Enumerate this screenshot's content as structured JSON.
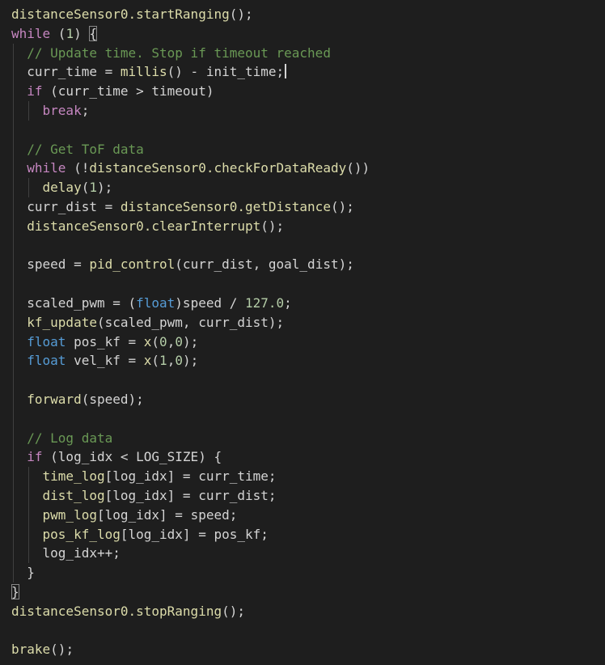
{
  "code": {
    "colors": {
      "background": "#1e1e1e",
      "default": "#d4d4d4",
      "keyword": "#c586c0",
      "function": "#dcdcaa",
      "comment": "#6a9955",
      "number": "#b5cea8",
      "type": "#569cd6",
      "variable": "#9cdcfe"
    },
    "lines": [
      {
        "indent": 0,
        "tokens": [
          {
            "t": "distanceSensor0.startRanging",
            "c": "function"
          },
          {
            "t": "();",
            "c": "default"
          }
        ]
      },
      {
        "indent": 0,
        "tokens": [
          {
            "t": "while",
            "c": "keyword"
          },
          {
            "t": " (",
            "c": "default"
          },
          {
            "t": "1",
            "c": "number"
          },
          {
            "t": ") ",
            "c": "default"
          },
          {
            "t": "{",
            "c": "default",
            "box": true
          }
        ]
      },
      {
        "indent": 1,
        "tokens": [
          {
            "t": "// Update time. Stop if timeout reached",
            "c": "comment"
          }
        ]
      },
      {
        "indent": 1,
        "tokens": [
          {
            "t": "curr_time = ",
            "c": "default"
          },
          {
            "t": "millis",
            "c": "function"
          },
          {
            "t": "() - init_time;",
            "c": "default"
          }
        ],
        "cursor": true
      },
      {
        "indent": 1,
        "tokens": [
          {
            "t": "if",
            "c": "keyword"
          },
          {
            "t": " (curr_time > timeout)",
            "c": "default"
          }
        ]
      },
      {
        "indent": 2,
        "tokens": [
          {
            "t": "break",
            "c": "keyword"
          },
          {
            "t": ";",
            "c": "default"
          }
        ]
      },
      {
        "indent": 1,
        "tokens": []
      },
      {
        "indent": 1,
        "tokens": [
          {
            "t": "// Get ToF data",
            "c": "comment"
          }
        ]
      },
      {
        "indent": 1,
        "tokens": [
          {
            "t": "while",
            "c": "keyword"
          },
          {
            "t": " (!",
            "c": "default"
          },
          {
            "t": "distanceSensor0.checkForDataReady",
            "c": "function"
          },
          {
            "t": "())",
            "c": "default"
          }
        ]
      },
      {
        "indent": 2,
        "tokens": [
          {
            "t": "delay",
            "c": "function"
          },
          {
            "t": "(",
            "c": "default"
          },
          {
            "t": "1",
            "c": "number"
          },
          {
            "t": ");",
            "c": "default"
          }
        ]
      },
      {
        "indent": 1,
        "tokens": [
          {
            "t": "curr_dist = ",
            "c": "default"
          },
          {
            "t": "distanceSensor0.getDistance",
            "c": "function"
          },
          {
            "t": "();",
            "c": "default"
          }
        ]
      },
      {
        "indent": 1,
        "tokens": [
          {
            "t": "distanceSensor0.clearInterrupt",
            "c": "function"
          },
          {
            "t": "();",
            "c": "default"
          }
        ]
      },
      {
        "indent": 1,
        "tokens": []
      },
      {
        "indent": 1,
        "tokens": [
          {
            "t": "speed = ",
            "c": "default"
          },
          {
            "t": "pid_control",
            "c": "function"
          },
          {
            "t": "(curr_dist, goal_dist);",
            "c": "default"
          }
        ]
      },
      {
        "indent": 1,
        "tokens": []
      },
      {
        "indent": 1,
        "tokens": [
          {
            "t": "scaled_pwm = (",
            "c": "default"
          },
          {
            "t": "float",
            "c": "type"
          },
          {
            "t": ")speed / ",
            "c": "default"
          },
          {
            "t": "127.0",
            "c": "number"
          },
          {
            "t": ";",
            "c": "default"
          }
        ]
      },
      {
        "indent": 1,
        "tokens": [
          {
            "t": "kf_update",
            "c": "function"
          },
          {
            "t": "(scaled_pwm, curr_dist);",
            "c": "default"
          }
        ]
      },
      {
        "indent": 1,
        "tokens": [
          {
            "t": "float",
            "c": "type"
          },
          {
            "t": " pos_kf = ",
            "c": "default"
          },
          {
            "t": "x",
            "c": "function"
          },
          {
            "t": "(",
            "c": "default"
          },
          {
            "t": "0",
            "c": "number"
          },
          {
            "t": ",",
            "c": "default"
          },
          {
            "t": "0",
            "c": "number"
          },
          {
            "t": ");",
            "c": "default"
          }
        ]
      },
      {
        "indent": 1,
        "tokens": [
          {
            "t": "float",
            "c": "type"
          },
          {
            "t": " vel_kf = ",
            "c": "default"
          },
          {
            "t": "x",
            "c": "function"
          },
          {
            "t": "(",
            "c": "default"
          },
          {
            "t": "1",
            "c": "number"
          },
          {
            "t": ",",
            "c": "default"
          },
          {
            "t": "0",
            "c": "number"
          },
          {
            "t": ");",
            "c": "default"
          }
        ]
      },
      {
        "indent": 1,
        "tokens": []
      },
      {
        "indent": 1,
        "tokens": [
          {
            "t": "forward",
            "c": "function"
          },
          {
            "t": "(speed);",
            "c": "default"
          }
        ]
      },
      {
        "indent": 1,
        "tokens": []
      },
      {
        "indent": 1,
        "tokens": [
          {
            "t": "// Log data",
            "c": "comment"
          }
        ]
      },
      {
        "indent": 1,
        "tokens": [
          {
            "t": "if",
            "c": "keyword"
          },
          {
            "t": " (log_idx < LOG_SIZE) {",
            "c": "default"
          }
        ]
      },
      {
        "indent": 2,
        "tokens": [
          {
            "t": "time_log",
            "c": "function"
          },
          {
            "t": "[log_idx] = curr_time;",
            "c": "default"
          }
        ]
      },
      {
        "indent": 2,
        "tokens": [
          {
            "t": "dist_log",
            "c": "function"
          },
          {
            "t": "[log_idx] = curr_dist;",
            "c": "default"
          }
        ]
      },
      {
        "indent": 2,
        "tokens": [
          {
            "t": "pwm_log",
            "c": "function"
          },
          {
            "t": "[log_idx] = speed;",
            "c": "default"
          }
        ]
      },
      {
        "indent": 2,
        "tokens": [
          {
            "t": "pos_kf_log",
            "c": "function"
          },
          {
            "t": "[log_idx] = pos_kf;",
            "c": "default"
          }
        ]
      },
      {
        "indent": 2,
        "tokens": [
          {
            "t": "log_idx++;",
            "c": "default"
          }
        ]
      },
      {
        "indent": 1,
        "tokens": [
          {
            "t": "}",
            "c": "default"
          }
        ]
      },
      {
        "indent": 0,
        "tokens": [
          {
            "t": "}",
            "c": "default",
            "box": true
          }
        ]
      },
      {
        "indent": 0,
        "tokens": [
          {
            "t": "distanceSensor0.stopRanging",
            "c": "function"
          },
          {
            "t": "();",
            "c": "default"
          }
        ]
      },
      {
        "indent": 0,
        "tokens": []
      },
      {
        "indent": 0,
        "tokens": [
          {
            "t": "brake",
            "c": "function"
          },
          {
            "t": "();",
            "c": "default"
          }
        ]
      }
    ]
  }
}
